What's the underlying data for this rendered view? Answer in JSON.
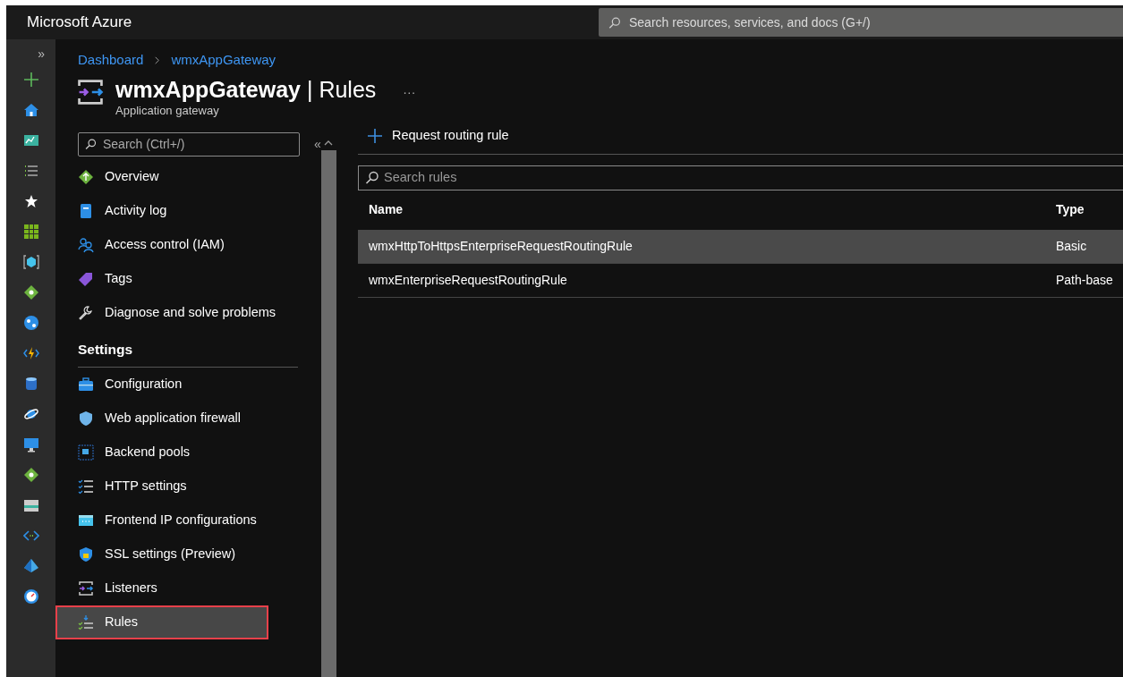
{
  "topbar": {
    "brand": "Microsoft Azure",
    "search": {
      "placeholder": "Search resources, services, and docs (G+/)"
    }
  },
  "rail": {
    "expand": "»"
  },
  "breadcrumb": [
    "Dashboard",
    "wmxAppGateway"
  ],
  "header": {
    "title": "wmxAppGateway",
    "separator": "|",
    "section": "Rules",
    "subtitle": "Application gateway",
    "more": "···"
  },
  "menu": {
    "search": {
      "placeholder": "Search (Ctrl+/)"
    },
    "collapse": "«",
    "items": [
      {
        "kind": "item",
        "label": "Overview",
        "selected": false,
        "outlined": false
      },
      {
        "kind": "item",
        "label": "Activity log",
        "selected": false,
        "outlined": false
      },
      {
        "kind": "item",
        "label": "Access control (IAM)",
        "selected": false,
        "outlined": false
      },
      {
        "kind": "item",
        "label": "Tags",
        "selected": false,
        "outlined": false
      },
      {
        "kind": "item",
        "label": "Diagnose and solve problems",
        "selected": false,
        "outlined": false
      },
      {
        "kind": "heading",
        "label": "Settings"
      },
      {
        "kind": "item",
        "label": "Configuration",
        "selected": false,
        "outlined": false
      },
      {
        "kind": "item",
        "label": "Web application firewall",
        "selected": false,
        "outlined": false
      },
      {
        "kind": "item",
        "label": "Backend pools",
        "selected": false,
        "outlined": false
      },
      {
        "kind": "item",
        "label": "HTTP settings",
        "selected": false,
        "outlined": false
      },
      {
        "kind": "item",
        "label": "Frontend IP configurations",
        "selected": false,
        "outlined": false
      },
      {
        "kind": "item",
        "label": "SSL settings (Preview)",
        "selected": false,
        "outlined": false
      },
      {
        "kind": "item",
        "label": "Listeners",
        "selected": false,
        "outlined": false
      },
      {
        "kind": "item",
        "label": "Rules",
        "selected": true,
        "outlined": true
      }
    ]
  },
  "toolbar": {
    "add_button": "Request routing rule"
  },
  "table": {
    "search": {
      "placeholder": "Search rules"
    },
    "columns": [
      "Name",
      "Type"
    ],
    "rows": [
      {
        "cells": [
          "wmxHttpToHttpsEnterpriseRequestRoutingRule",
          "Basic"
        ],
        "selected": true
      },
      {
        "cells": [
          "wmxEnterpriseRequestRoutingRule",
          "Path-base"
        ],
        "selected": false
      }
    ]
  }
}
